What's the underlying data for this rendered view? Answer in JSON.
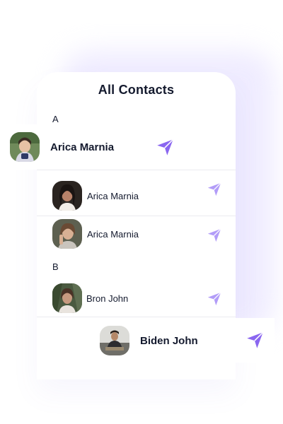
{
  "title": "All Contacts",
  "sections": [
    {
      "letter": "A"
    },
    {
      "letter": "B"
    }
  ],
  "contacts": [
    {
      "name": "Arica Marnia",
      "icon": "send-icon",
      "highlight": true
    },
    {
      "name": "Arica Marnia",
      "icon": "send-icon"
    },
    {
      "name": "Arica Marnia",
      "icon": "send-icon"
    },
    {
      "name": "Bron John",
      "icon": "send-icon"
    },
    {
      "name": "Biden John",
      "icon": "send-icon",
      "highlight": true
    }
  ],
  "colors": {
    "accent": "#8a66f0",
    "accent_light": "#b29cf8",
    "glow": "#ece8ff",
    "text": "#141a2e"
  }
}
